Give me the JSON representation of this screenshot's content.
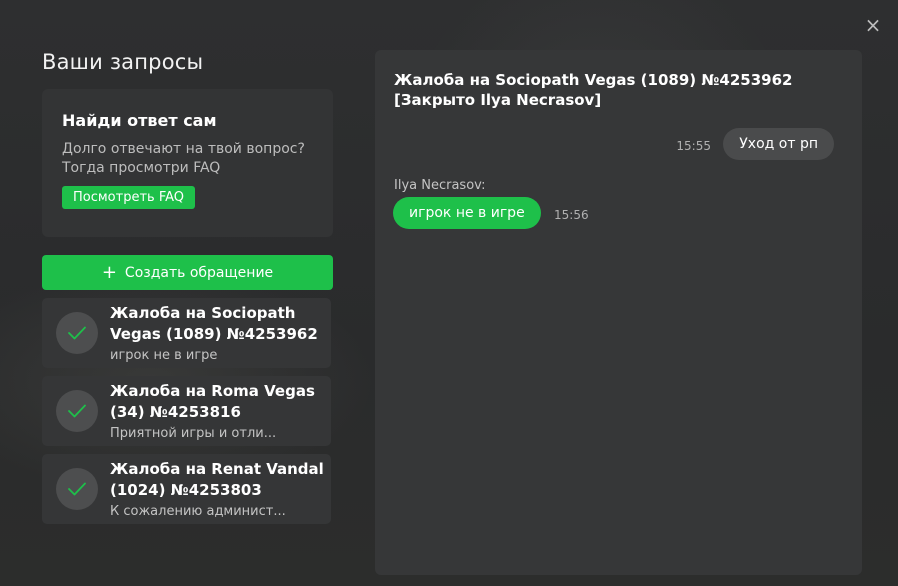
{
  "window": {
    "close_label": "×"
  },
  "page_title": "Ваши запросы",
  "faq": {
    "title": "Найди ответ сам",
    "text": "Долго отвечают на твой вопрос? Тогда просмотри FAQ",
    "button_label": "Посмотреть FAQ"
  },
  "create_button": {
    "icon": "+",
    "label": "Создать обращение"
  },
  "requests": [
    {
      "title": "Жалоба на Sociopath Vegas (1089) №4253962",
      "preview": "игрок не в игре"
    },
    {
      "title": "Жалоба на Roma Vegas (34) №4253816",
      "preview": "Приятной игры и отли..."
    },
    {
      "title": "Жалоба на Renat Vandal (1024) №4253803",
      "preview": "К сожалению админист..."
    }
  ],
  "chat": {
    "title": "Жалоба на Sociopath Vegas (1089) №4253962 [Закрыто Ilya Necrasov]",
    "messages": [
      {
        "side": "right",
        "time": "15:55",
        "text": "Уход от рп"
      },
      {
        "side": "left",
        "sender": "Ilya Necrasov:",
        "time": "15:56",
        "text": "игрок не в игре"
      }
    ]
  },
  "colors": {
    "accent": "#1ec04a",
    "panel": "#363738",
    "card": "#333435"
  }
}
